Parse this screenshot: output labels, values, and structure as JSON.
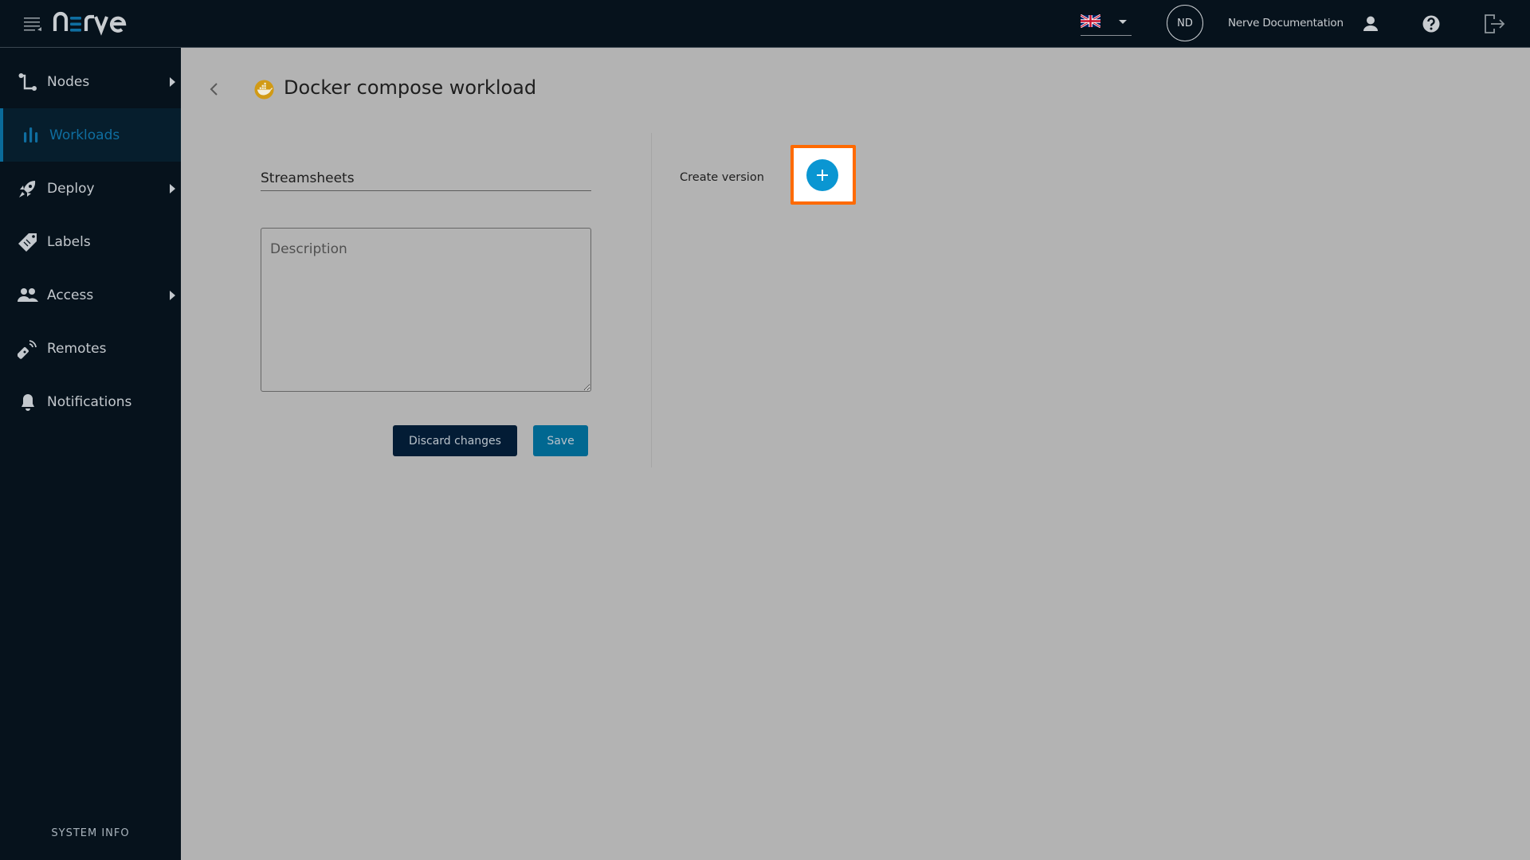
{
  "header": {
    "logo_text": "nerve",
    "language": "English (UK)",
    "avatar_initials": "ND",
    "username": "Nerve Documentation",
    "icons": [
      "menu-icon",
      "uk-flag-icon",
      "chevron-down-icon",
      "user-icon",
      "help-icon",
      "logout-icon"
    ]
  },
  "sidebar": {
    "items": [
      {
        "label": "Nodes",
        "icon": "nodes-icon",
        "has_submenu": true,
        "active": false
      },
      {
        "label": "Workloads",
        "icon": "workloads-icon",
        "has_submenu": false,
        "active": true
      },
      {
        "label": "Deploy",
        "icon": "rocket-icon",
        "has_submenu": true,
        "active": false
      },
      {
        "label": "Labels",
        "icon": "tag-icon",
        "has_submenu": false,
        "active": false
      },
      {
        "label": "Access",
        "icon": "users-icon",
        "has_submenu": true,
        "active": false
      },
      {
        "label": "Remotes",
        "icon": "remote-icon",
        "has_submenu": false,
        "active": false
      },
      {
        "label": "Notifications",
        "icon": "bell-icon",
        "has_submenu": false,
        "active": false
      }
    ],
    "system_info": "SYSTEM INFO"
  },
  "main": {
    "title": "Docker compose workload",
    "name_value": "Streamsheets",
    "description_placeholder": "Description",
    "description_value": "",
    "discard_label": "Discard changes",
    "save_label": "Save",
    "create_version_label": "Create version"
  },
  "colors": {
    "header_bg": "#06121c",
    "sidebar_bg": "#06121c",
    "active_accent": "#0a6b9a",
    "content_bg": "#b3b3b3",
    "discard_bg": "#031c35",
    "save_bg": "#016891",
    "add_button": "#0a96d2",
    "highlight": "#ff6a00"
  }
}
